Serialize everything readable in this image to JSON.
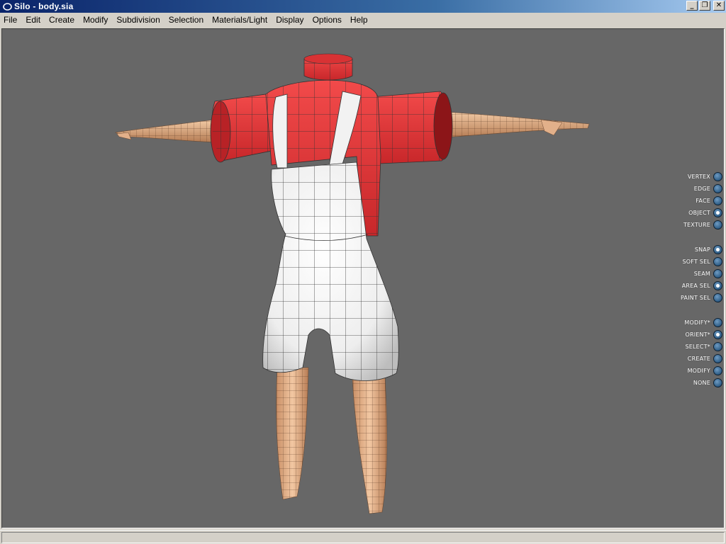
{
  "window": {
    "title": "Silo  - body.sia",
    "buttons": {
      "minimize": "_",
      "maximize": "❐",
      "close": "✕"
    }
  },
  "menu": [
    "File",
    "Edit",
    "Create",
    "Modify",
    "Subdivision",
    "Selection",
    "Materials/Light",
    "Display",
    "Options",
    "Help"
  ],
  "modes": {
    "selection": [
      {
        "label": "VERTEX",
        "active": false
      },
      {
        "label": "EDGE",
        "active": false
      },
      {
        "label": "FACE",
        "active": false
      },
      {
        "label": "OBJECT",
        "active": true
      },
      {
        "label": "TEXTURE",
        "active": false
      }
    ],
    "options": [
      {
        "label": "SNAP",
        "active": true
      },
      {
        "label": "SOFT SEL",
        "active": false
      },
      {
        "label": "SEAM",
        "active": false
      },
      {
        "label": "AREA SEL",
        "active": true
      },
      {
        "label": "PAINT SEL",
        "active": false
      }
    ],
    "tools": [
      {
        "label": "MODIFY*",
        "active": false
      },
      {
        "label": "ORIENT*",
        "active": true
      },
      {
        "label": "SELECT*",
        "active": false
      },
      {
        "label": "CREATE",
        "active": false
      },
      {
        "label": "MODIFY",
        "active": false
      },
      {
        "label": "NONE",
        "active": false
      }
    ]
  },
  "status": {
    "text": ""
  },
  "colors": {
    "viewport_bg": "#676767",
    "shirt": "#e8393a",
    "overalls": "#f4f4f4",
    "skin": "#e9b993",
    "mode_button": "#2e5d86"
  }
}
